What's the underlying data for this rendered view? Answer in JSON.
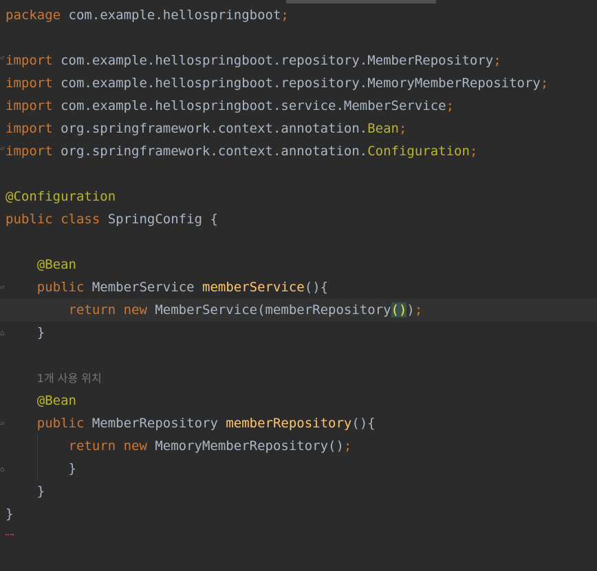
{
  "editor": {
    "line_package": {
      "kw": "package",
      "name": "com.example.hellospringboot",
      "semi": ";"
    },
    "imports": [
      {
        "kw": "import",
        "path": "com.example.hellospringboot.repository.",
        "cls": "MemberRepository",
        "semi": ";"
      },
      {
        "kw": "import",
        "path": "com.example.hellospringboot.repository.",
        "cls": "MemoryMemberRepository",
        "semi": ";"
      },
      {
        "kw": "import",
        "path": "com.example.hellospringboot.service.",
        "cls": "MemberService",
        "semi": ";"
      },
      {
        "kw": "import",
        "path": "org.springframework.context.annotation.",
        "cls": "Bean",
        "semi": ";"
      },
      {
        "kw": "import",
        "path": "org.springframework.context.annotation.",
        "cls": "Configuration",
        "semi": ";"
      }
    ],
    "class_annotation": "@Configuration",
    "class_decl": {
      "kw": "public class",
      "name": "SpringConfig",
      "brace": "{"
    },
    "method1": {
      "annotation": "@Bean",
      "kw": "public",
      "type": "MemberService",
      "name": "memberService",
      "sig": "(){",
      "ret_kw": "return new",
      "ret_call": "MemberService(memberRepository",
      "ret_paren": "()",
      "ret_close": ")",
      "ret_semi": ";",
      "close": "}"
    },
    "usage_hint": "1개 사용 위치",
    "method2": {
      "annotation": "@Bean",
      "kw": "public",
      "type": "MemberRepository",
      "name": "memberRepository",
      "sig": "(){",
      "ret_kw": "return new",
      "ret_call": "MemoryMemberRepository()",
      "ret_semi": ";",
      "close_inner": "}",
      "close": "}"
    },
    "class_close": "}"
  }
}
